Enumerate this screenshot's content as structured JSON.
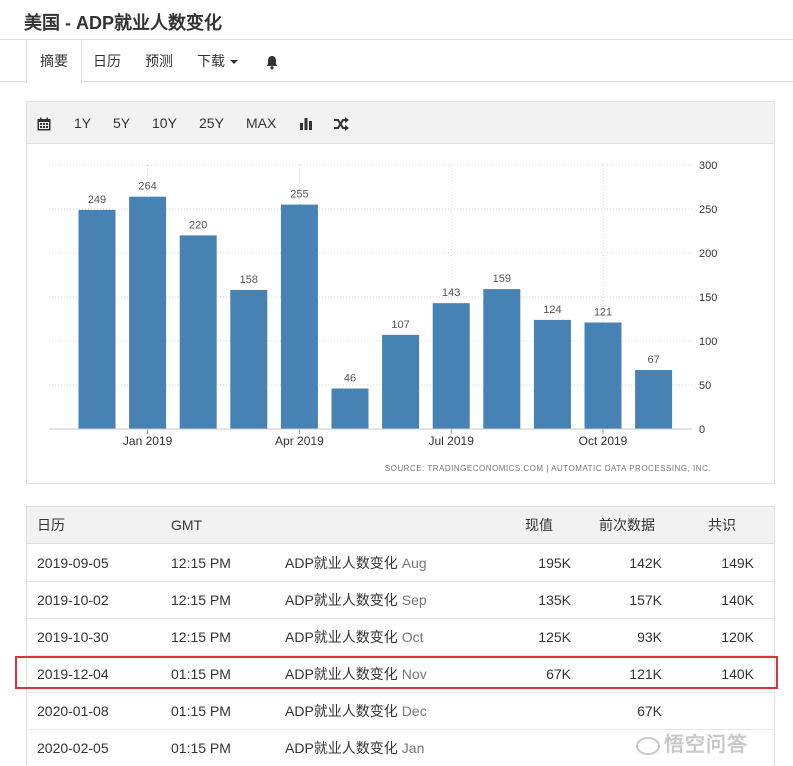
{
  "page": {
    "title": "美国 - ADP就业人数变化"
  },
  "nav": {
    "tabs": [
      {
        "label": "摘要",
        "active": true
      },
      {
        "label": "日历"
      },
      {
        "label": "预测"
      },
      {
        "label": "下载"
      }
    ]
  },
  "toolbar": {
    "ranges": [
      "1Y",
      "5Y",
      "10Y",
      "25Y",
      "MAX"
    ],
    "icons": [
      "calendar-icon",
      "bar-chart-icon",
      "shuffle-icon",
      "bell-icon"
    ]
  },
  "chart_data": {
    "type": "bar",
    "values": [
      249,
      264,
      220,
      158,
      255,
      46,
      107,
      143,
      159,
      124,
      121,
      67
    ],
    "x_tick_labels": [
      "Jan 2019",
      "Apr 2019",
      "Jul 2019",
      "Oct 2019"
    ],
    "y_ticks": [
      0,
      50,
      100,
      150,
      200,
      250,
      300
    ],
    "ylim": [
      0,
      300
    ],
    "y_axis_side": "right",
    "grid": true,
    "bar_color": "#4682b4",
    "source": "SOURCE: TRADINGECONOMICS.COM | AUTOMATIC DATA PROCESSING, INC."
  },
  "table": {
    "headers": {
      "date": "日历",
      "time": "GMT",
      "actual": "现值",
      "previous": "前次数据",
      "consensus": "共识"
    },
    "rows": [
      {
        "date": "2019-09-05",
        "time": "12:15 PM",
        "event": "ADP就业人数变化",
        "period": "Aug",
        "actual": "195K",
        "previous": "142K",
        "consensus": "149K"
      },
      {
        "date": "2019-10-02",
        "time": "12:15 PM",
        "event": "ADP就业人数变化",
        "period": "Sep",
        "actual": "135K",
        "previous": "157K",
        "consensus": "140K"
      },
      {
        "date": "2019-10-30",
        "time": "12:15 PM",
        "event": "ADP就业人数变化",
        "period": "Oct",
        "actual": "125K",
        "previous": "93K",
        "consensus": "120K"
      },
      {
        "date": "2019-12-04",
        "time": "01:15 PM",
        "event": "ADP就业人数变化",
        "period": "Nov",
        "actual": "67K",
        "previous": "121K",
        "consensus": "140K",
        "highlighted": true
      },
      {
        "date": "2020-01-08",
        "time": "01:15 PM",
        "event": "ADP就业人数变化",
        "period": "Dec",
        "actual": "",
        "previous": "67K",
        "consensus": ""
      },
      {
        "date": "2020-02-05",
        "time": "01:15 PM",
        "event": "ADP就业人数变化",
        "period": "Jan",
        "actual": "",
        "previous": "",
        "consensus": ""
      }
    ]
  },
  "watermark": {
    "text": "悟空问答"
  },
  "colors": {
    "highlight_border": "#d9343a",
    "toolbar_bg": "#f2f2f2"
  }
}
